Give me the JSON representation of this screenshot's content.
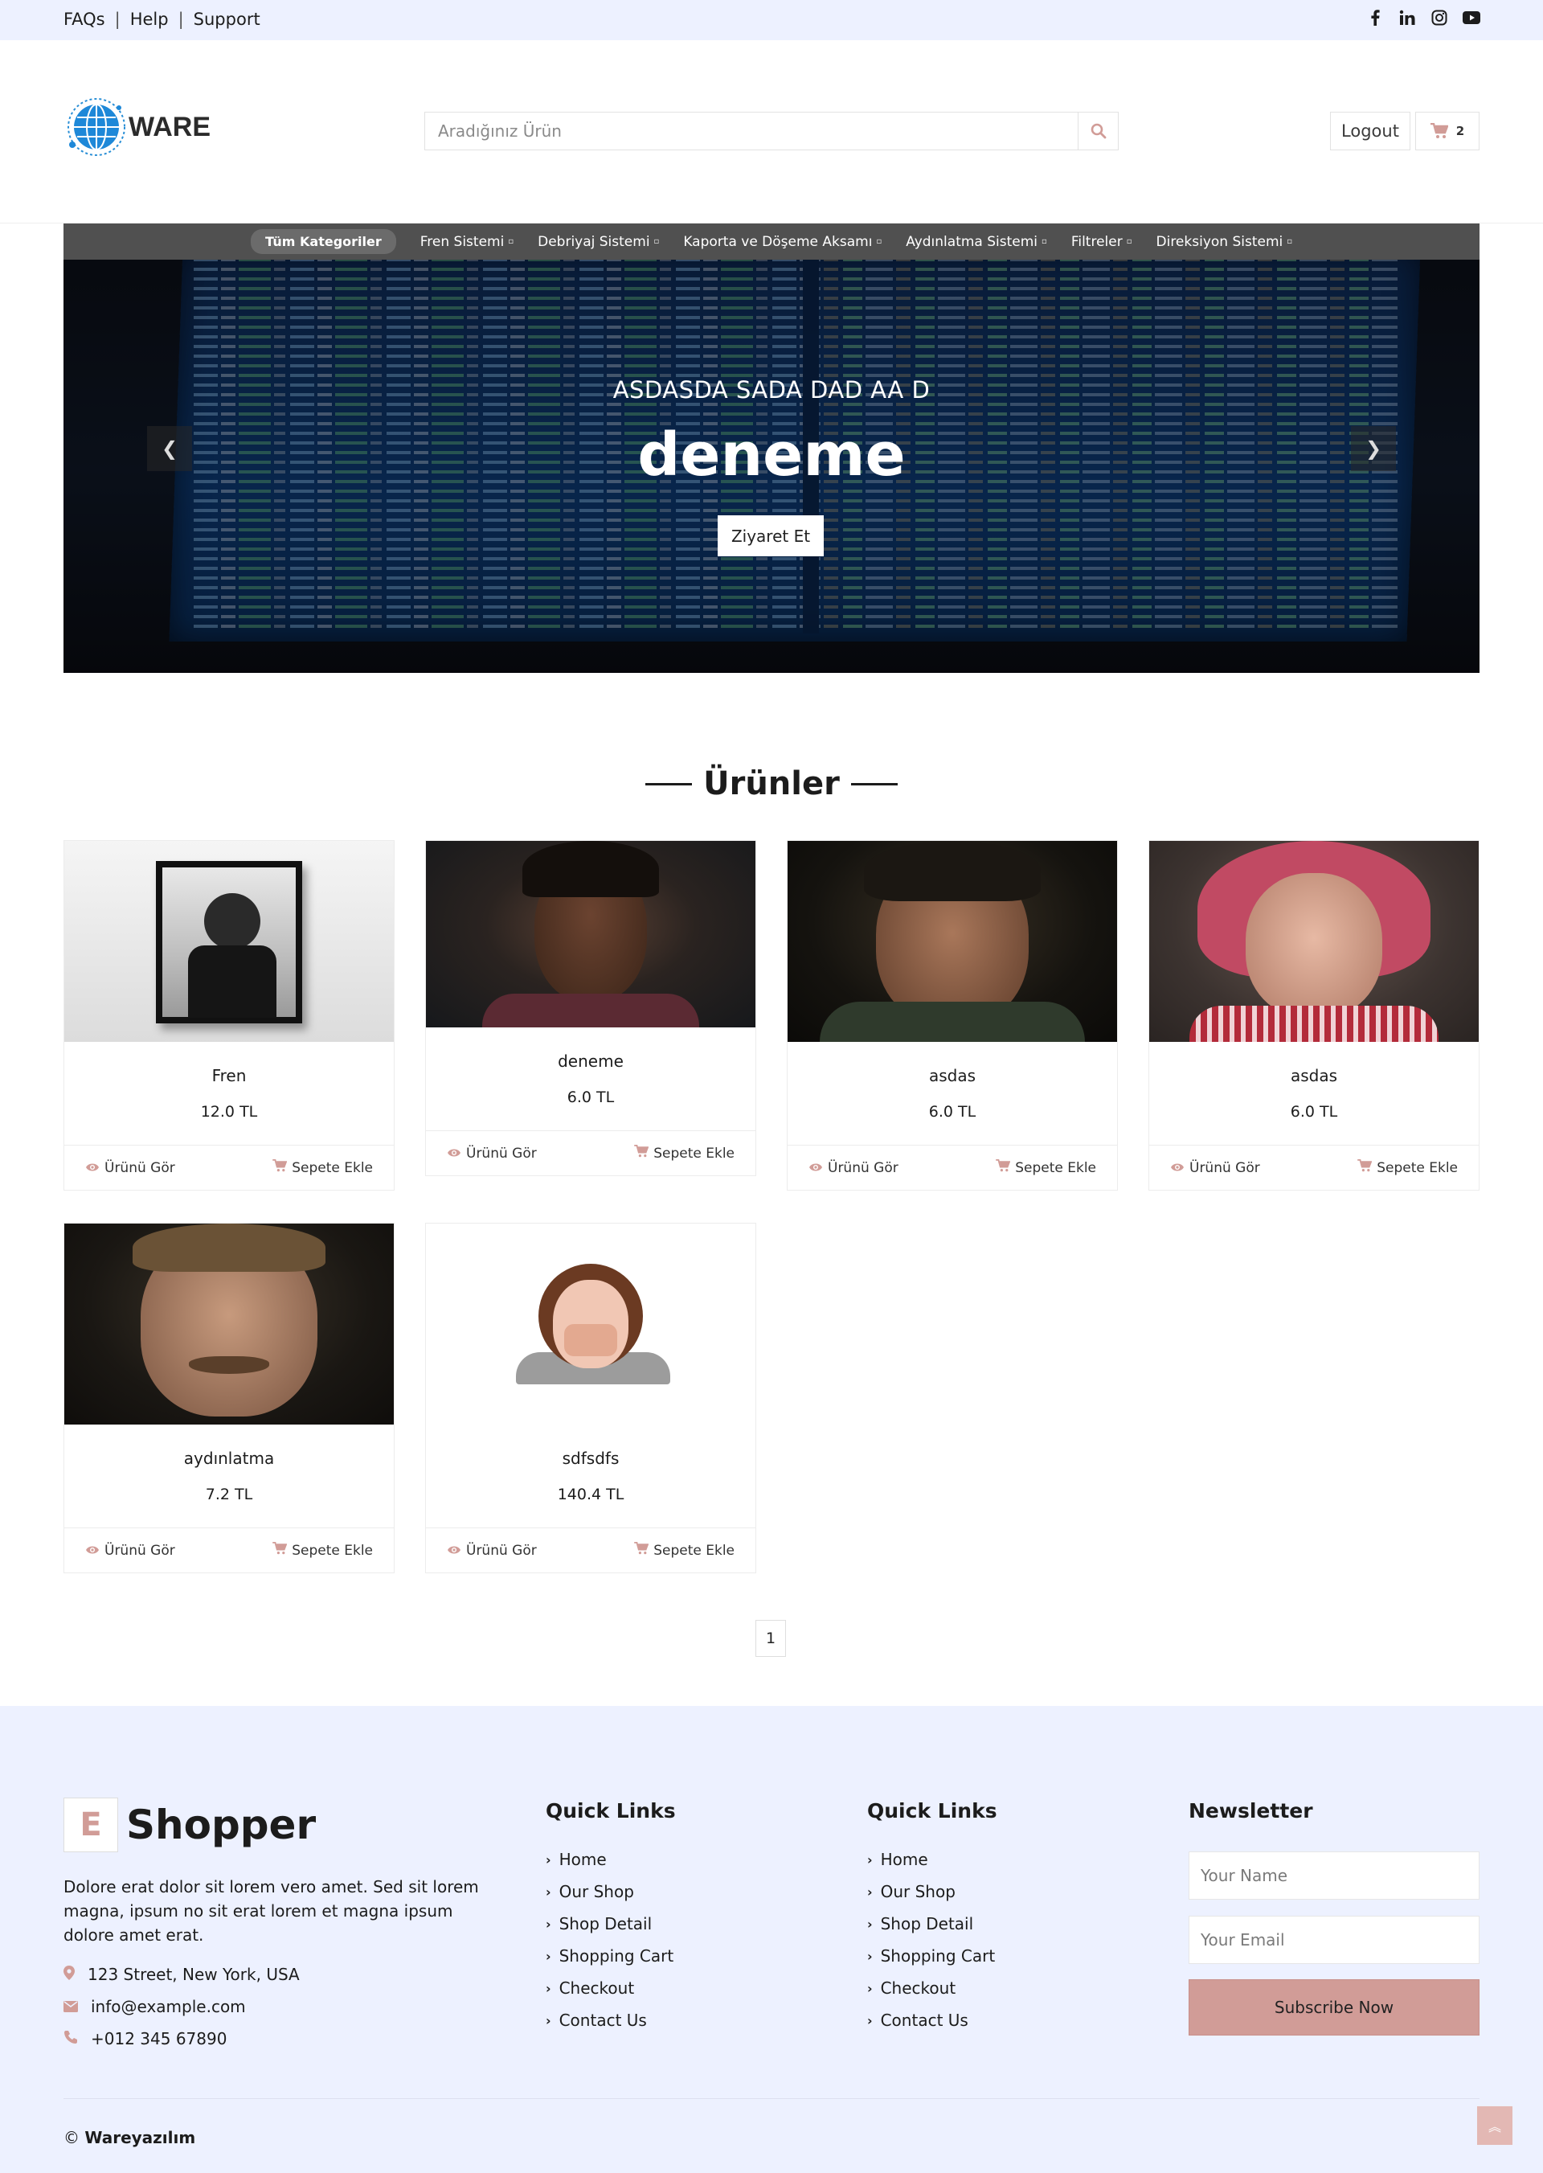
{
  "topbar": {
    "links": [
      "FAQs",
      "Help",
      "Support"
    ],
    "social_icons": [
      "facebook-icon",
      "linkedin-icon",
      "instagram-icon",
      "youtube-icon"
    ]
  },
  "header": {
    "logo_text": "WARE",
    "search_placeholder": "Aradığınız Ürün",
    "logout_label": "Logout",
    "cart_count": "2"
  },
  "category_nav": {
    "active": "Tüm Kategoriler",
    "items": [
      "Fren Sistemi",
      "Debriyaj Sistemi",
      "Kaporta ve Döşeme Aksamı",
      "Aydınlatma Sistemi",
      "Filtreler",
      "Direksiyon Sistemi"
    ]
  },
  "carousel": {
    "subtitle": "ASDASDA SADA DAD AA D",
    "title": "deneme",
    "button_label": "Ziyaret Et"
  },
  "products_section": {
    "title": "Ürünler",
    "view_label": "Ürünü Gör",
    "add_label": "Sepete Ekle",
    "items": [
      {
        "name": "Fren",
        "price": "12.0 TL"
      },
      {
        "name": "deneme",
        "price": "6.0 TL"
      },
      {
        "name": "asdas",
        "price": "6.0 TL"
      },
      {
        "name": "asdas",
        "price": "6.0 TL"
      },
      {
        "name": "aydınlatma",
        "price": "7.2 TL"
      },
      {
        "name": "sdfsdfs",
        "price": "140.4 TL"
      }
    ]
  },
  "pagination": {
    "current": "1"
  },
  "footer": {
    "brand_letter": "E",
    "brand_name": "Shopper",
    "description": "Dolore erat dolor sit lorem vero amet. Sed sit lorem magna, ipsum no sit erat lorem et magna ipsum dolore amet erat.",
    "address": "123 Street, New York, USA",
    "email": "info@example.com",
    "phone": "+012 345 67890",
    "quick_links_1": {
      "title": "Quick Links",
      "items": [
        "Home",
        "Our Shop",
        "Shop Detail",
        "Shopping Cart",
        "Checkout",
        "Contact Us"
      ]
    },
    "quick_links_2": {
      "title": "Quick Links",
      "items": [
        "Home",
        "Our Shop",
        "Shop Detail",
        "Shopping Cart",
        "Checkout",
        "Contact Us"
      ]
    },
    "newsletter": {
      "title": "Newsletter",
      "name_placeholder": "Your Name",
      "email_placeholder": "Your Email",
      "button_label": "Subscribe Now"
    },
    "copyright_symbol": "©",
    "copyright_name": "Wareyazılım"
  },
  "colors": {
    "accent": "#d19c97",
    "topbar_bg": "#edf1ff",
    "catnav_bg": "#505050"
  }
}
